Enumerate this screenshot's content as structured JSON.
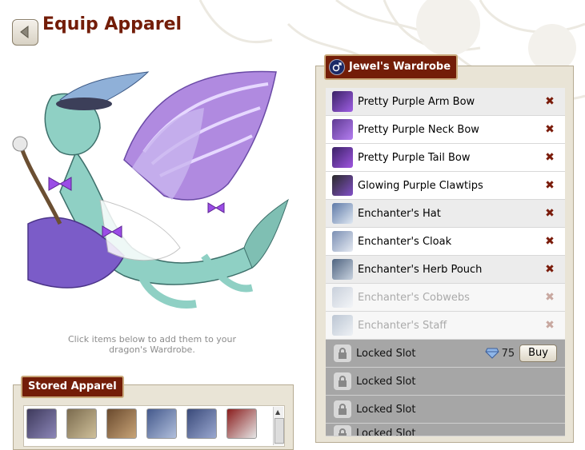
{
  "page": {
    "title": "Equip Apparel",
    "hint": "Click items below to add them to your dragon's Wardrobe."
  },
  "wardrobe": {
    "title": "Jewel's Wardrobe",
    "items": [
      {
        "label": "Pretty Purple Arm Bow",
        "state": "equipped",
        "icon": "purple-bow",
        "remove": "✖"
      },
      {
        "label": "Pretty Purple Neck Bow",
        "state": "equipped",
        "icon": "purple-bow",
        "remove": "✖"
      },
      {
        "label": "Pretty Purple Tail Bow",
        "state": "equipped",
        "icon": "purple-bow",
        "remove": "✖"
      },
      {
        "label": "Glowing Purple Clawtips",
        "state": "equipped",
        "icon": "purple-claws",
        "remove": "✖"
      },
      {
        "label": "Enchanter's Hat",
        "state": "equipped",
        "icon": "enchanter-hat",
        "remove": "✖"
      },
      {
        "label": "Enchanter's Cloak",
        "state": "equipped",
        "icon": "enchanter-cloak",
        "remove": "✖"
      },
      {
        "label": "Enchanter's Herb Pouch",
        "state": "equipped",
        "icon": "herb-pouch",
        "remove": "✖"
      },
      {
        "label": "Enchanter's Cobwebs",
        "state": "hidden",
        "icon": "cobwebs",
        "remove": "✖"
      },
      {
        "label": "Enchanter's Staff",
        "state": "hidden",
        "icon": "staff",
        "remove": "✖"
      }
    ],
    "locked": [
      {
        "label": "Locked Slot",
        "cost": "75",
        "buy_label": "Buy",
        "icon": "lock-icon"
      },
      {
        "label": "Locked Slot",
        "icon": "lock-icon"
      },
      {
        "label": "Locked Slot",
        "icon": "lock-icon"
      },
      {
        "label": "Locked Slot",
        "icon": "lock-icon"
      }
    ]
  },
  "stored": {
    "title": "Stored Apparel",
    "items": [
      {
        "icon": "witch-hat-purple"
      },
      {
        "icon": "fur-hat-tan"
      },
      {
        "icon": "brown-hat"
      },
      {
        "icon": "blue-wrap"
      },
      {
        "icon": "blue-cloak"
      },
      {
        "icon": "red-feathers"
      }
    ]
  },
  "colors": {
    "title_brown": "#731d08",
    "tab_border": "#c9a97b",
    "panel_bg": "#e9e4d6",
    "remove_x": "#7a1b0a",
    "locked_bg": "#a6a6a6",
    "dragon_body": "#8fd0c4",
    "wing_purple": "#b08ae0"
  }
}
